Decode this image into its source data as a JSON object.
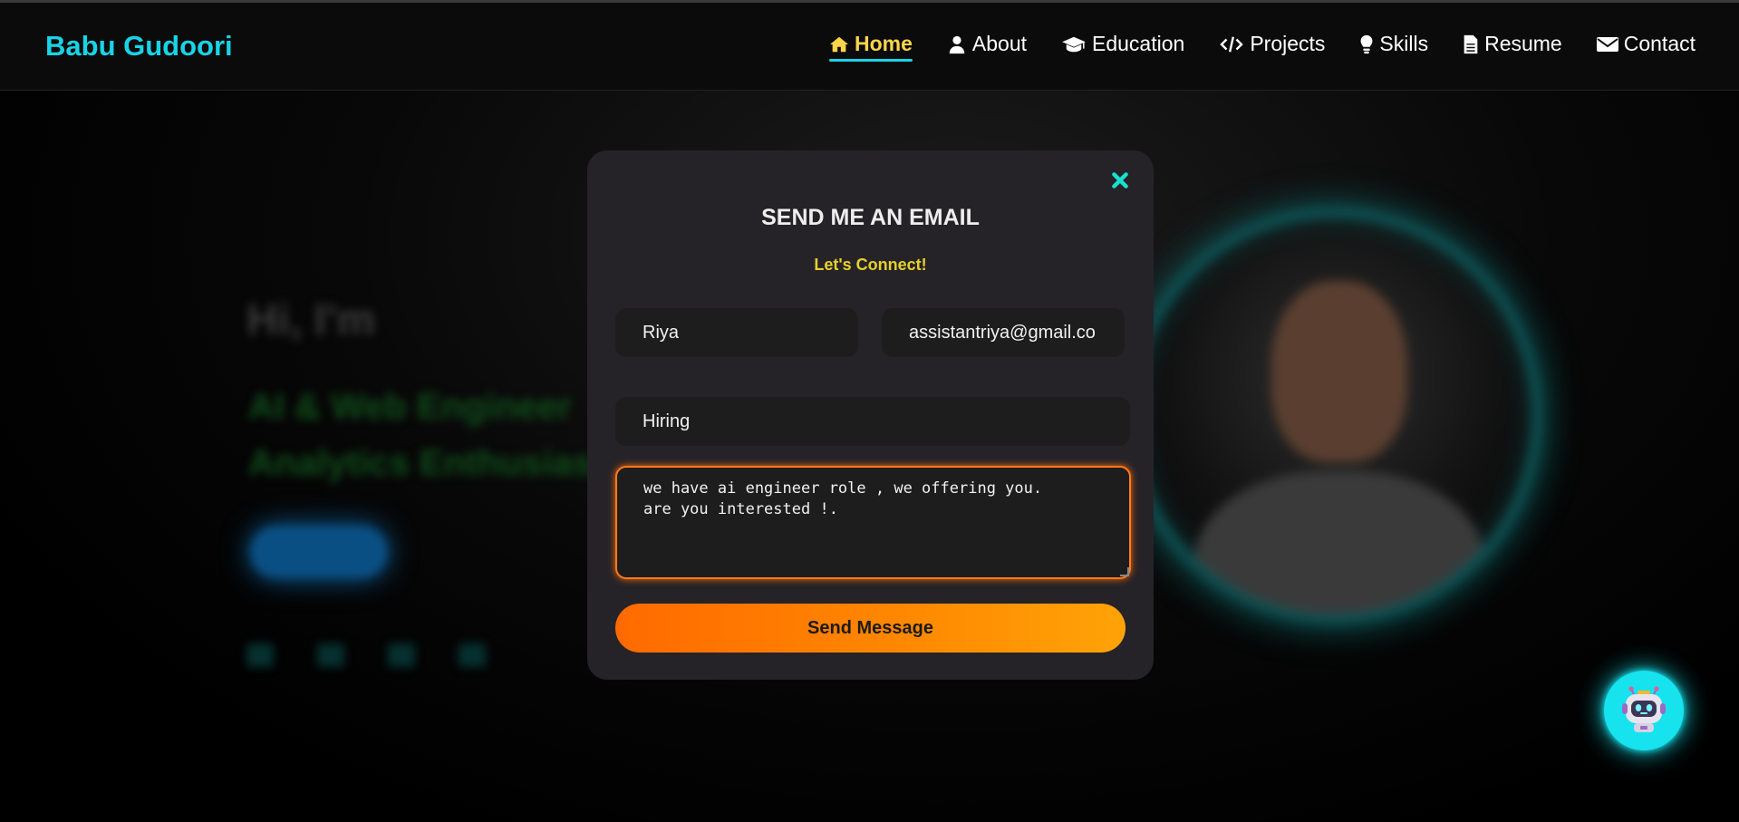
{
  "brand": "Babu Gudoori",
  "nav": {
    "items": [
      {
        "label": "Home",
        "icon": "home-icon",
        "active": true
      },
      {
        "label": "About",
        "icon": "user-icon",
        "active": false
      },
      {
        "label": "Education",
        "icon": "graduation-cap-icon",
        "active": false
      },
      {
        "label": "Projects",
        "icon": "code-icon",
        "active": false
      },
      {
        "label": "Skills",
        "icon": "lightbulb-icon",
        "active": false
      },
      {
        "label": "Resume",
        "icon": "document-icon",
        "active": false
      },
      {
        "label": "Contact",
        "icon": "envelope-icon",
        "active": false
      }
    ]
  },
  "hero": {
    "greeting": "Hi, I'm",
    "role": "AI & Web Engineer Analytics Enthusiast"
  },
  "modal": {
    "title": "SEND ME AN EMAIL",
    "subtitle": "Let's Connect!",
    "fields": {
      "name": "Riya",
      "email": "assistantriya@gmail.co",
      "subject": "Hiring",
      "message": "we have ai engineer role , we offering you.\nare you interested !."
    },
    "send_label": "Send Message"
  },
  "colors": {
    "brand": "#19d3e6",
    "active_nav": "#ffd54a",
    "subtitle": "#e6d12a",
    "accent_orange": "#ff7a1a",
    "chatbot": "#16e3ee"
  }
}
